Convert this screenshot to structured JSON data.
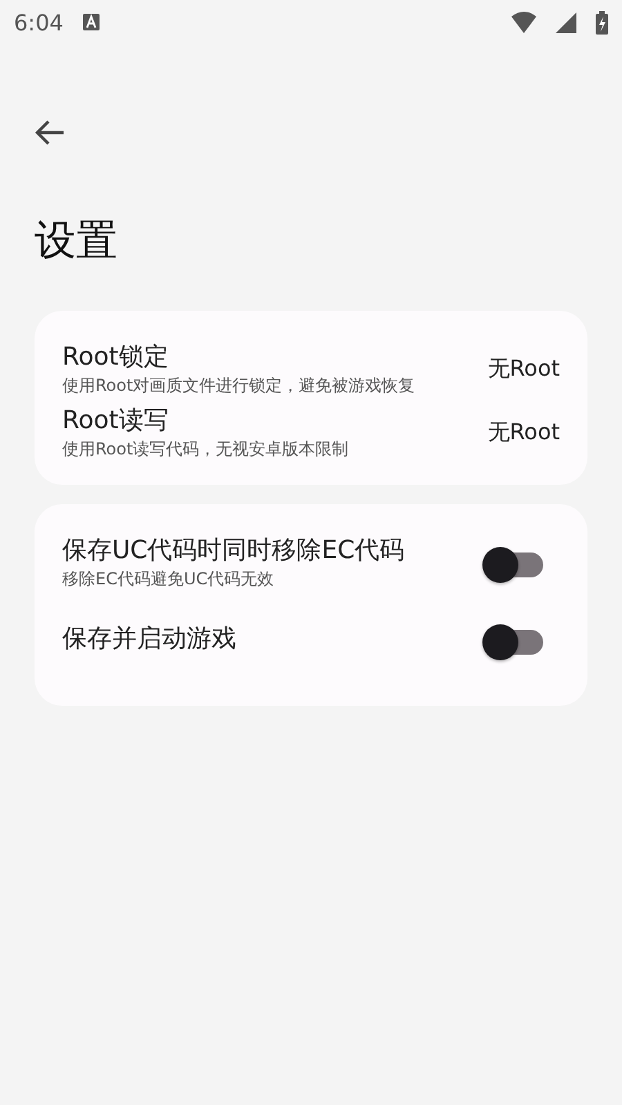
{
  "status_bar": {
    "time": "6:04"
  },
  "title": "设置",
  "root_card": {
    "items": [
      {
        "title": "Root锁定",
        "description": "使用Root对画质文件进行锁定，避免被游戏恢复",
        "value": "无Root"
      },
      {
        "title": "Root读写",
        "description": "使用Root读写代码，无视安卓版本限制",
        "value": "无Root"
      }
    ]
  },
  "toggle_card": {
    "items": [
      {
        "title": "保存UC代码时同时移除EC代码",
        "description": "移除EC代码避免UC代码无效",
        "on": false
      },
      {
        "title": "保存并启动游戏",
        "on": false
      }
    ]
  }
}
